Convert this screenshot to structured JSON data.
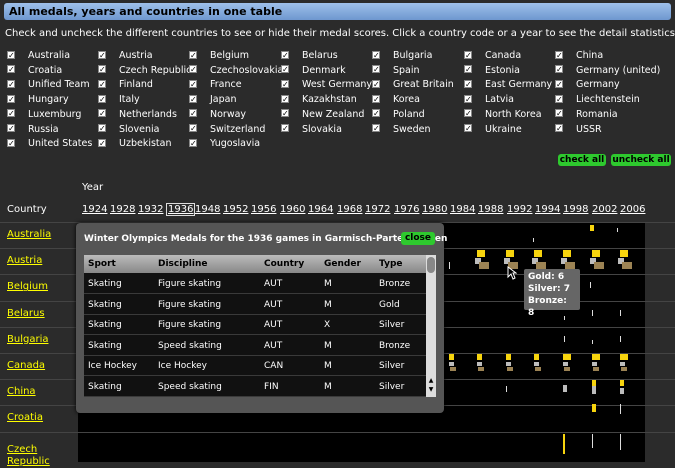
{
  "title": "All medals, years and countries in one table",
  "instructions": "Check and uncheck the different countries to see or hide their medal scores. Click a country code or a year to see the detail statistics.",
  "countries": [
    [
      "Australia",
      "Austria",
      "Belgium",
      "Belarus",
      "Bulgaria",
      "Canada",
      "China"
    ],
    [
      "Croatia",
      "Czech Republic",
      "Czechoslovakia",
      "Denmark",
      "Spain",
      "Estonia",
      "Germany (united)"
    ],
    [
      "Unified Team",
      "Finland",
      "France",
      "West Germany",
      "Great Britain",
      "East Germany",
      "Germany"
    ],
    [
      "Hungary",
      "Italy",
      "Japan",
      "Kazakhstan",
      "Korea",
      "Latvia",
      "Liechtenstein"
    ],
    [
      "Luxemburg",
      "Netherlands",
      "Norway",
      "New Zealand",
      "Poland",
      "North Korea",
      "Romania"
    ],
    [
      "Russia",
      "Slovenia",
      "Switzerland",
      "Slovakia",
      "Sweden",
      "Ukraine",
      "USSR"
    ],
    [
      "United States",
      "Uzbekistan",
      "Yugoslavia"
    ]
  ],
  "check_all_label": "check all",
  "uncheck_all_label": "uncheck all",
  "year_label": "Year",
  "country_label": "Country",
  "years": [
    "1924",
    "1928",
    "1932",
    "1936",
    "1948",
    "1952",
    "1956",
    "1960",
    "1964",
    "1968",
    "1972",
    "1976",
    "1980",
    "1984",
    "1988",
    "1992",
    "1994",
    "1998",
    "2002",
    "2006"
  ],
  "selected_year": "1936",
  "chart_rows": [
    "Australia",
    "Austria",
    "Belgium",
    "Belarus",
    "Bulgaria",
    "Canada",
    "China",
    "Croatia",
    "Czech Republic"
  ],
  "popup": {
    "title": "Winter Olympics Medals for the 1936 games in Garmisch-Partenkirchen",
    "close_label": "close",
    "columns": [
      "Sport",
      "Discipline",
      "Country",
      "Gender",
      "Type"
    ],
    "rows": [
      [
        "Skating",
        "Figure skating",
        "AUT",
        "M",
        "Bronze"
      ],
      [
        "Skating",
        "Figure skating",
        "AUT",
        "M",
        "Gold"
      ],
      [
        "Skating",
        "Figure skating",
        "AUT",
        "X",
        "Silver"
      ],
      [
        "Skating",
        "Speed skating",
        "AUT",
        "M",
        "Bronze"
      ],
      [
        "Ice Hockey",
        "Ice Hockey",
        "CAN",
        "M",
        "Silver"
      ],
      [
        "Skating",
        "Speed skating",
        "FIN",
        "M",
        "Silver"
      ]
    ]
  },
  "tooltip": {
    "gold": "Gold: 6",
    "silver": "Silver: 7",
    "bronze": "Bronze: 8"
  },
  "colors": {
    "gold": "#f7d40e",
    "silver": "#bdbdbd",
    "bronze": "#9c8354",
    "button": "#2ec92e",
    "country_link": "#ffff00"
  }
}
